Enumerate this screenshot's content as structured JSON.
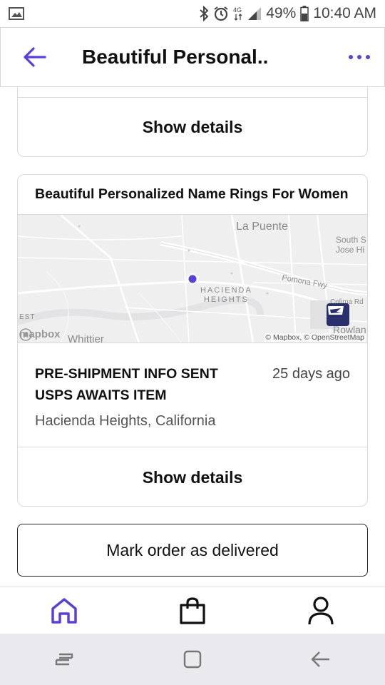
{
  "status_bar": {
    "battery": "49%",
    "time": "10:40 AM",
    "network": "4G"
  },
  "header": {
    "title": "Beautiful Personal..",
    "accent_color": "#5b3fd6"
  },
  "previous_card": {
    "show_details_label": "Show details"
  },
  "order_card": {
    "title": "Beautiful Personalized Name Rings For Women",
    "map": {
      "labels": {
        "la_puente": "La Puente",
        "south_san_jose_hills": "South S\nJose Hi",
        "pomona_fwy": "Pomona Fwy",
        "hacienda_heights": "HACIENDA\nHEIGHTS",
        "colima_rd": "Colima Rd",
        "rowland": "Rowlan",
        "whittier": "Whittier",
        "est": "EST",
        "attribution": "© Mapbox, © OpenStreetMap",
        "mapbox_logo": "mapbox"
      },
      "carrier_icon": "usps-eagle-icon"
    },
    "status_title": "PRE-SHIPMENT INFO SENT USPS AWAITS ITEM",
    "status_time": "25 days ago",
    "status_location": "Hacienda Heights, California",
    "show_details_label": "Show details"
  },
  "mark_delivered_label": "Mark order as delivered",
  "bottom_nav": {
    "items": [
      {
        "icon": "home-icon",
        "active": true
      },
      {
        "icon": "shopping-bag-icon",
        "active": false
      },
      {
        "icon": "profile-icon",
        "active": false
      }
    ],
    "active_color": "#5b3fd6"
  },
  "system_nav": {
    "items": [
      "recent-apps-icon",
      "home-square-icon",
      "back-arrow-icon"
    ]
  }
}
